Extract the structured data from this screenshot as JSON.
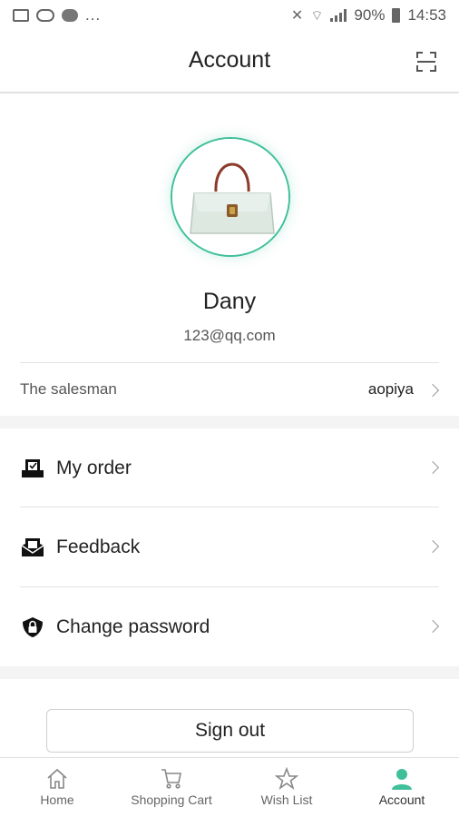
{
  "status_bar": {
    "left_icons": [
      "image-icon",
      "wechat-icon",
      "chat-bubble-icon"
    ],
    "more": "...",
    "battery": "90%",
    "time": "14:53"
  },
  "header": {
    "title": "Account",
    "scan_icon": "scan-icon"
  },
  "profile": {
    "name": "Dany",
    "email": "123@qq.com",
    "salesman_label": "The salesman",
    "salesman_value": "aopiya",
    "accent_color": "#3fbf9a"
  },
  "menu": {
    "items": [
      {
        "label": "My order",
        "icon": "order-icon"
      },
      {
        "label": "Feedback",
        "icon": "feedback-icon"
      },
      {
        "label": "Change password",
        "icon": "lock-icon"
      }
    ]
  },
  "sign_out": {
    "label": "Sign out"
  },
  "bottom_nav": {
    "tabs": [
      {
        "label": "Home",
        "icon": "home-icon"
      },
      {
        "label": "Shopping Cart",
        "icon": "cart-icon"
      },
      {
        "label": "Wish List",
        "icon": "star-icon"
      },
      {
        "label": "Account",
        "icon": "person-icon",
        "active": true
      }
    ],
    "active_color": "#3fbf9a"
  }
}
